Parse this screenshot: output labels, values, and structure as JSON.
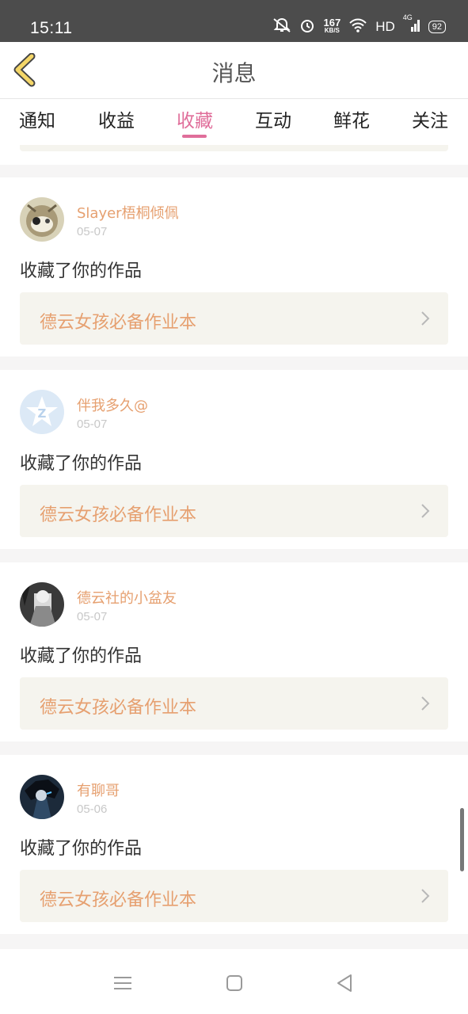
{
  "status_bar": {
    "time": "15:11",
    "speed_value": "167",
    "speed_unit": "KB/S",
    "hd": "HD",
    "network": "4G",
    "battery": "92"
  },
  "header": {
    "title": "消息",
    "back_icon": "chevron-left-icon"
  },
  "tabs": [
    {
      "label": "通知",
      "active": false
    },
    {
      "label": "收益",
      "active": false
    },
    {
      "label": "收藏",
      "active": true
    },
    {
      "label": "互动",
      "active": false
    },
    {
      "label": "鲜花",
      "active": false
    },
    {
      "label": "关注",
      "active": false
    }
  ],
  "colors": {
    "accent": "#e06e9a",
    "username": "#e6a070",
    "work_bg": "#f5f4ee"
  },
  "messages": [
    {
      "username": "Slayer梧桐倾佩",
      "date": "05-07",
      "action": "收藏了你的作品",
      "work": "德云女孩必备作业本"
    },
    {
      "username": "伴我多久@",
      "date": "05-07",
      "action": "收藏了你的作品",
      "work": "德云女孩必备作业本"
    },
    {
      "username": "德云社的小盆友",
      "date": "05-07",
      "action": "收藏了你的作品",
      "work": "德云女孩必备作业本"
    },
    {
      "username": "有聊哥",
      "date": "05-06",
      "action": "收藏了你的作品",
      "work": "德云女孩必备作业本"
    }
  ]
}
